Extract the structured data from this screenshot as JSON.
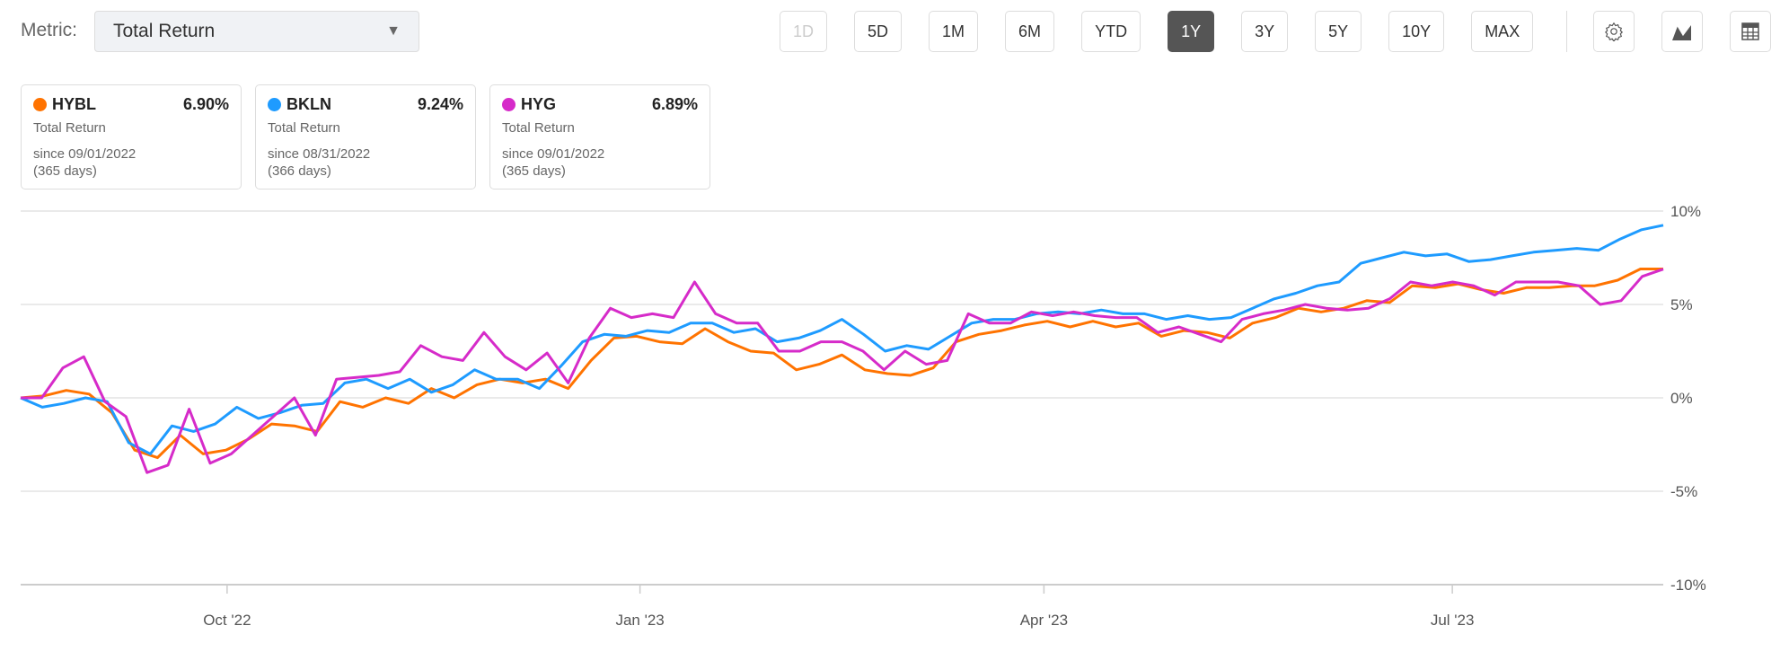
{
  "header": {
    "metric_label": "Metric:",
    "metric_value": "Total Return",
    "ranges": [
      {
        "label": "1D",
        "state": "disabled"
      },
      {
        "label": "5D",
        "state": ""
      },
      {
        "label": "1M",
        "state": ""
      },
      {
        "label": "6M",
        "state": ""
      },
      {
        "label": "YTD",
        "state": ""
      },
      {
        "label": "1Y",
        "state": "active"
      },
      {
        "label": "3Y",
        "state": ""
      },
      {
        "label": "5Y",
        "state": ""
      },
      {
        "label": "10Y",
        "state": ""
      },
      {
        "label": "MAX",
        "state": ""
      }
    ],
    "tools": [
      "gear-icon",
      "area-chart-icon",
      "table-icon"
    ]
  },
  "cards": [
    {
      "ticker": "HYBL",
      "value": "6.90%",
      "metric": "Total Return",
      "since": "since 09/01/2022",
      "days": "(365 days)",
      "color": "#ff7300"
    },
    {
      "ticker": "BKLN",
      "value": "9.24%",
      "metric": "Total Return",
      "since": "since 08/31/2022",
      "days": "(366 days)",
      "color": "#1e9bff"
    },
    {
      "ticker": "HYG",
      "value": "6.89%",
      "metric": "Total Return",
      "since": "since 09/01/2022",
      "days": "(365 days)",
      "color": "#d62bc9"
    }
  ],
  "chart_data": {
    "type": "line",
    "title": "",
    "xlabel": "",
    "ylabel": "",
    "x_range": [
      "2022-08-16",
      "2023-08-17"
    ],
    "ylim": [
      -10,
      10
    ],
    "y_ticks": [
      {
        "v": 10,
        "label": "10%"
      },
      {
        "v": 5,
        "label": "5%"
      },
      {
        "v": 0,
        "label": "0%"
      },
      {
        "v": -5,
        "label": "-5%"
      },
      {
        "v": -10,
        "label": "-10%"
      }
    ],
    "x_ticks": [
      {
        "date": "2022-10-01",
        "label": "Oct '22"
      },
      {
        "date": "2023-01-01",
        "label": "Jan '23"
      },
      {
        "date": "2023-04-01",
        "label": "Apr '23"
      },
      {
        "date": "2023-07-01",
        "label": "Jul '23"
      }
    ],
    "grid": true,
    "series": [
      {
        "name": "HYBL",
        "color": "#ff7300",
        "values": [
          0,
          0.1,
          0.4,
          0.2,
          -0.8,
          -2.8,
          -3.2,
          -2.0,
          -3.0,
          -2.8,
          -2.2,
          -1.4,
          -1.5,
          -1.8,
          -0.2,
          -0.5,
          0,
          -0.3,
          0.5,
          0,
          0.7,
          1.0,
          0.8,
          1.0,
          0.5,
          2.0,
          3.2,
          3.3,
          3.0,
          2.9,
          3.7,
          3.0,
          2.5,
          2.4,
          1.5,
          1.8,
          2.3,
          1.5,
          1.3,
          1.2,
          1.6,
          3.0,
          3.4,
          3.6,
          3.9,
          4.1,
          3.8,
          4.1,
          3.8,
          4.0,
          3.3,
          3.6,
          3.5,
          3.2,
          4.0,
          4.3,
          4.8,
          4.6,
          4.8,
          5.2,
          5.1,
          6.0,
          5.9,
          6.1,
          5.8,
          5.6,
          5.9,
          5.9,
          6.0,
          6.0,
          6.3,
          6.9,
          6.9
        ]
      },
      {
        "name": "BKLN",
        "color": "#1e9bff",
        "values": [
          0,
          -0.5,
          -0.3,
          0,
          -0.2,
          -2.4,
          -3.0,
          -1.5,
          -1.8,
          -1.4,
          -0.5,
          -1.1,
          -0.8,
          -0.4,
          -0.3,
          0.8,
          1.0,
          0.5,
          1.0,
          0.3,
          0.7,
          1.5,
          1.0,
          1.0,
          0.5,
          1.7,
          3.0,
          3.4,
          3.3,
          3.6,
          3.5,
          4.0,
          4.0,
          3.5,
          3.7,
          3.0,
          3.2,
          3.6,
          4.2,
          3.4,
          2.5,
          2.8,
          2.6,
          3.3,
          4.0,
          4.2,
          4.2,
          4.5,
          4.6,
          4.5,
          4.7,
          4.5,
          4.5,
          4.2,
          4.4,
          4.2,
          4.3,
          4.8,
          5.3,
          5.6,
          6.0,
          6.2,
          7.2,
          7.5,
          7.8,
          7.6,
          7.7,
          7.3,
          7.4,
          7.6,
          7.8,
          7.9,
          8.0,
          7.9,
          8.5,
          9.0,
          9.24
        ]
      },
      {
        "name": "HYG",
        "color": "#d62bc9",
        "values": [
          0,
          0,
          1.6,
          2.2,
          -0.2,
          -1.0,
          -4.0,
          -3.6,
          -0.6,
          -3.5,
          -3.0,
          -2.0,
          -1.0,
          0,
          -2.0,
          1.0,
          1.1,
          1.2,
          1.4,
          2.8,
          2.2,
          2.0,
          3.5,
          2.2,
          1.5,
          2.4,
          0.8,
          3.2,
          4.8,
          4.3,
          4.5,
          4.3,
          6.2,
          4.5,
          4.0,
          4.0,
          2.5,
          2.5,
          3.0,
          3.0,
          2.5,
          1.5,
          2.5,
          1.8,
          2.0,
          4.5,
          4.0,
          4.0,
          4.6,
          4.4,
          4.6,
          4.4,
          4.3,
          4.3,
          3.5,
          3.8,
          3.4,
          3.0,
          4.2,
          4.5,
          4.7,
          5.0,
          4.8,
          4.7,
          4.8,
          5.3,
          6.2,
          6.0,
          6.2,
          6.0,
          5.5,
          6.2,
          6.2,
          6.2,
          6.0,
          5.0,
          5.2,
          6.5,
          6.89
        ]
      }
    ]
  }
}
